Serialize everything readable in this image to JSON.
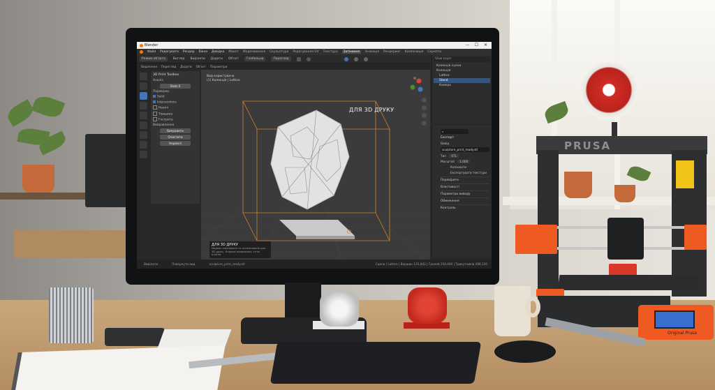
{
  "window": {
    "title": "Blender",
    "minimize": "—",
    "maximize": "☐",
    "close": "✕"
  },
  "menubar": {
    "items": [
      "Файл",
      "Редагувати",
      "Рендер",
      "Вікно",
      "Довідка"
    ],
    "tabs": [
      "Макет",
      "Моделювання",
      "Скульптура",
      "Редагування UV",
      "Текстура",
      "Затінення",
      "Анімація",
      "Рендеринг",
      "Композиція",
      "Скрипти"
    ],
    "active_tab_index": 5
  },
  "header": {
    "mode": "Режим об'єкта",
    "view": "Вигляд",
    "select": "Виділити",
    "add": "Додати",
    "object": "Об'єкт",
    "orientation": "Глобальна",
    "pivot": "Перегляд"
  },
  "toolbar2": {
    "items": [
      "Виділення",
      "Перегляд",
      "Додати",
      "Об'єкт",
      "Параметри"
    ]
  },
  "tool_panel": {
    "title": "3D Print Toolbox",
    "analyze_header": "Аналіз",
    "stats_button": "Stats 0",
    "checks_header": "Перевірки",
    "checks": [
      {
        "label": "Solid",
        "checked": true
      },
      {
        "label": "Intersections",
        "checked": true
      },
      {
        "label": "Нахил",
        "checked": false
      },
      {
        "label": "Товщина",
        "checked": false
      },
      {
        "label": "Гострота",
        "checked": false
      }
    ],
    "cleanup_header": "Виправлення",
    "cleanup_buttons": [
      "Виправити",
      "Очистити",
      "Нормалі"
    ]
  },
  "viewport": {
    "info_line1": "Вид користувача",
    "info_line2": "(1) Колекція | Lattice",
    "label": "ДЛЯ 3D ДРУКУ",
    "note_title": "ДЛЯ 3D ДРУКУ",
    "note_body": "Модель перевірена та оптимізована для 3D друку. Нормалі виправлені, сітка цілісна."
  },
  "outliner": {
    "header": "View Layer",
    "rows": [
      {
        "label": "Колекція сцени",
        "selected": false
      },
      {
        "label": "Колекція",
        "selected": false
      },
      {
        "label": "Lattice",
        "selected": false
      },
      {
        "label": "Stand",
        "selected": true
      },
      {
        "label": "Камера",
        "selected": false
      }
    ]
  },
  "properties": {
    "title": "Експорт",
    "output_header": "Вивід",
    "filepath": "sculpture_print_ready.stl",
    "format_label": "Тип",
    "format_value": "STL",
    "scale_label": "Масштаб",
    "scale_value": "1.000",
    "options": [
      "Копіювати",
      "Експортувати текстури"
    ],
    "sections": [
      "Перевірити",
      "Властивості",
      "Параметри виводу",
      "Обмеження",
      "Контроль"
    ]
  },
  "statusbar": {
    "left": "Виділити",
    "middle": "Повернути вид",
    "file": "sculpture_print_ready.stl",
    "right": "Сцена | Lattice | Вершин 125,842 | Граней 250,000 | Трикутників 498,120"
  },
  "printer": {
    "brand": "PRUSA",
    "lcd_label": "Original Prusa"
  },
  "colors": {
    "blender_bg": "#282828",
    "accent_blue": "#4772b3",
    "bbox_orange": "#d4822f",
    "prusa_orange": "#ef5a23"
  }
}
